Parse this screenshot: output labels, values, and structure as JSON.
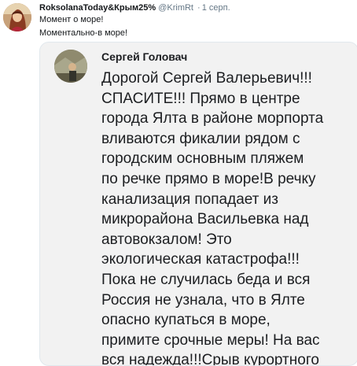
{
  "tweet": {
    "author_name": "RoksolanaToday&Крым25%",
    "handle": "@KrimRt",
    "separator": "·",
    "date": "1 серп.",
    "text_lines": [
      "Момент о море!",
      "Моментально-в море!"
    ],
    "avatar_icon": "profile-avatar-portrait"
  },
  "media": {
    "quoted_author": "Сергей Головач",
    "quoted_avatar_icon": "profile-avatar-photo",
    "quoted_text_lines": [
      "Дорогой Сергей Валерьевич!!!",
      "СПАСИТЕ!!! Прямо в центре",
      "города Ялта в районе морпорта",
      "вливаются фикалии рядом с",
      "городским основным пляжем",
      "по речке прямо в море!В речку",
      "канализация попадает из",
      "микрорайона Васильевка над",
      "автовокзалом! Это",
      "экологическая катастрофа!!!",
      "Пока не случилась беда и вся",
      "Россия не узнала, что в Ялте",
      "опасно купаться в море,",
      "примите срочные меры! На вас",
      "вся надежда!!!Срыв курортного"
    ]
  },
  "colors": {
    "text": "#14171a",
    "secondary": "#657786",
    "media_bg": "#f2f2f2",
    "border": "#e1e8ed"
  }
}
